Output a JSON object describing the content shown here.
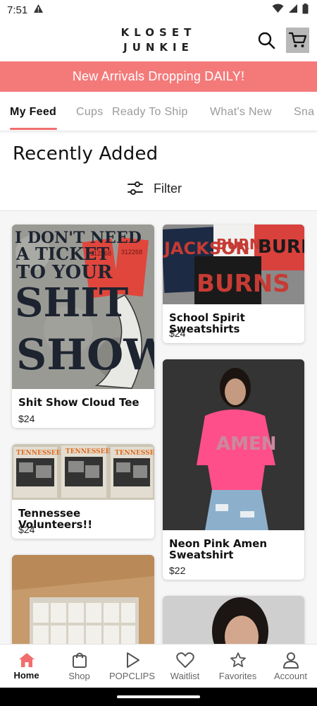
{
  "status_bar": {
    "time": "7:51"
  },
  "header": {
    "logo_line1": "KLOSET",
    "logo_line2": "JUNKIE"
  },
  "promo": {
    "text": "New Arrivals Dropping DAILY!"
  },
  "tabs": [
    {
      "label": "My Feed",
      "active": true
    },
    {
      "label": "Cups"
    },
    {
      "label": "Ready To Ship"
    },
    {
      "label": "What's New"
    },
    {
      "label": "Sna"
    }
  ],
  "section": {
    "title": "Recently Added",
    "filter_label": "Filter"
  },
  "products": [
    {
      "title": "Shit Show Cloud Tee",
      "price": "$24",
      "img_text": [
        "I DON'T NEED",
        "A TICKET",
        "TO YOUR",
        "SHIT",
        "SHOW"
      ]
    },
    {
      "title": "School Spirit Sweatshirts",
      "price": "$24",
      "img_text": [
        "JACKSON",
        "BURNS",
        "BURNS",
        "BURNS"
      ]
    },
    {
      "title": "Tennessee Volunteers!!",
      "price": "$24",
      "img_text": [
        "TENNESSEE",
        "TENNESSEE",
        "TENNESSEE"
      ]
    },
    {
      "title": "Neon Pink Amen Sweatshirt",
      "price": "$22",
      "img_text": [
        "AMEN"
      ]
    }
  ],
  "bottom_nav": [
    {
      "label": "Home",
      "icon": "home-icon",
      "active": true
    },
    {
      "label": "Shop",
      "icon": "shopping-bag-icon"
    },
    {
      "label": "POPCLIPS",
      "icon": "play-icon"
    },
    {
      "label": "Waitlist",
      "icon": "heart-icon"
    },
    {
      "label": "Favorites",
      "icon": "star-icon"
    },
    {
      "label": "Account",
      "icon": "person-icon"
    }
  ],
  "colors": {
    "accent": "#f47a7a",
    "underline": "#f26d6d",
    "home_icon": "#f26d6d"
  }
}
